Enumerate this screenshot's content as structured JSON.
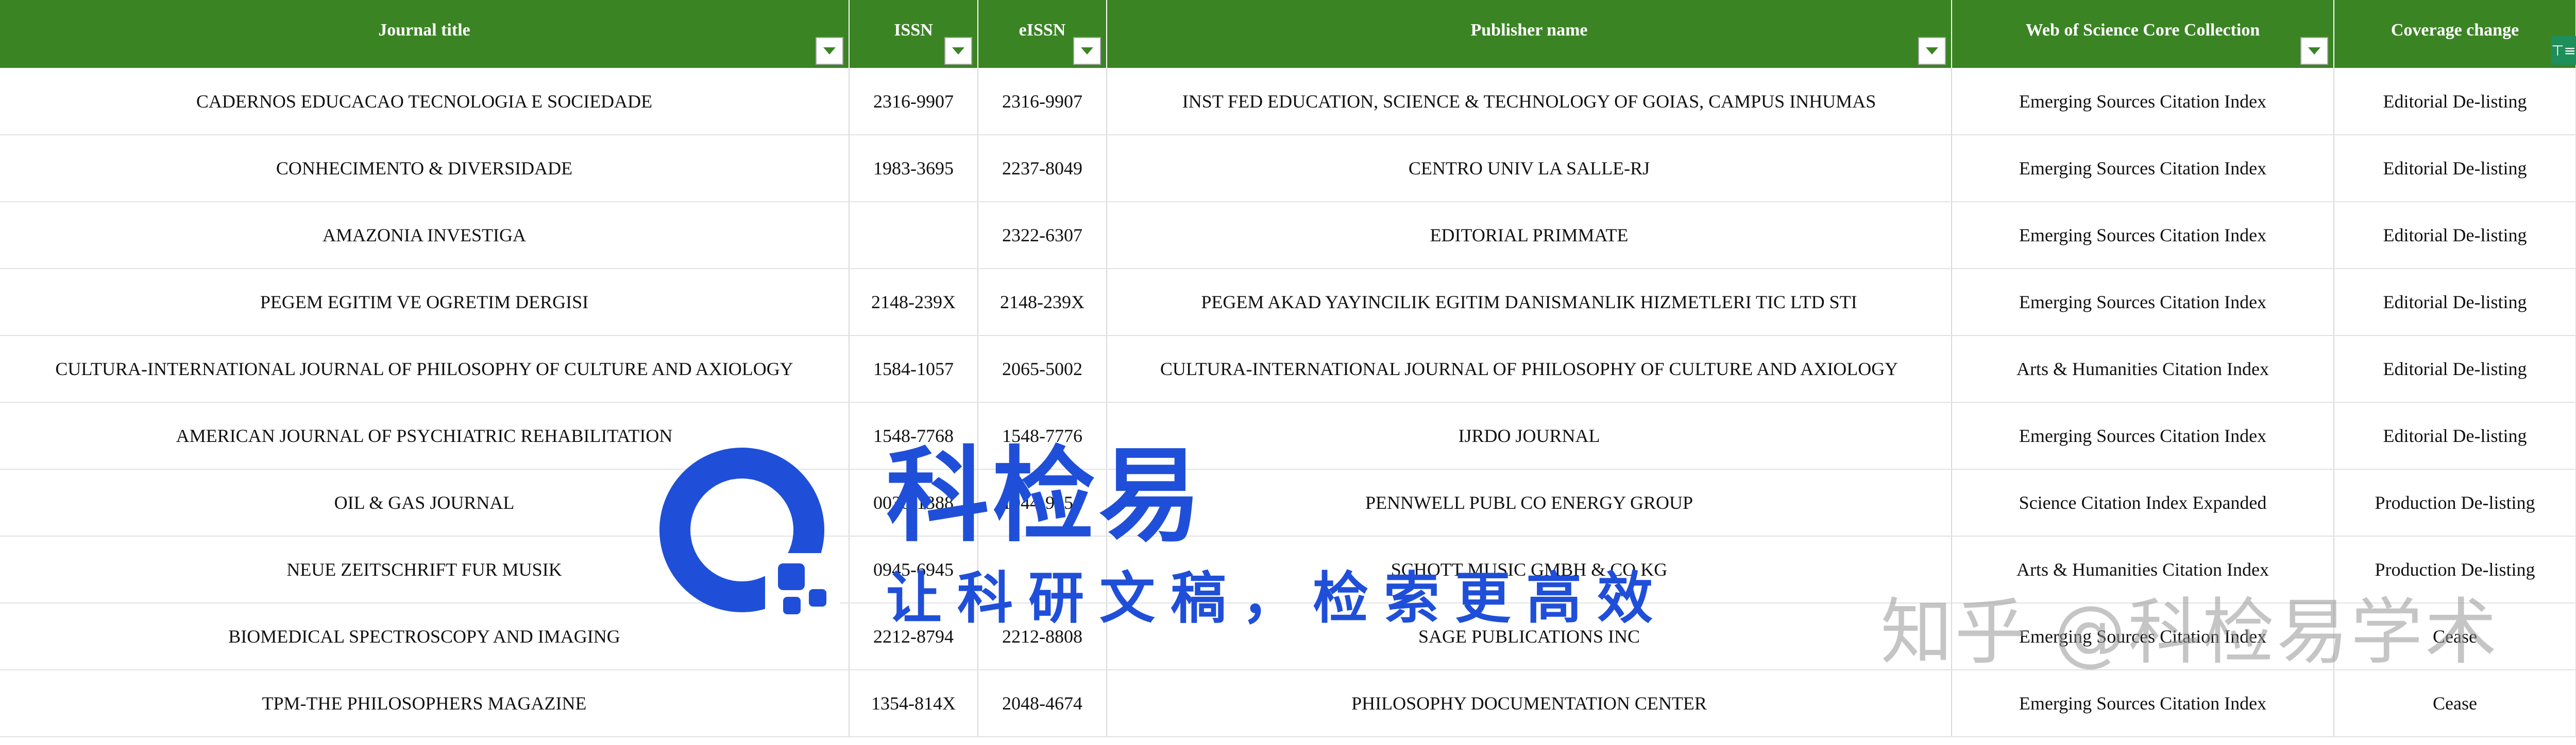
{
  "columns": [
    {
      "label": "Journal title",
      "filter": true
    },
    {
      "label": "ISSN",
      "filter": true
    },
    {
      "label": "eISSN",
      "filter": true
    },
    {
      "label": "Publisher name",
      "filter": true
    },
    {
      "label": "Web of Science Core Collection",
      "filter": true
    },
    {
      "label": "Coverage change",
      "filter": true
    }
  ],
  "rows": [
    [
      "CADERNOS EDUCACAO TECNOLOGIA E SOCIEDADE",
      "2316-9907",
      "2316-9907",
      "INST FED EDUCATION, SCIENCE & TECHNOLOGY OF GOIAS, CAMPUS INHUMAS",
      "Emerging Sources Citation Index",
      "Editorial De-listing"
    ],
    [
      "CONHECIMENTO & DIVERSIDADE",
      "1983-3695",
      "2237-8049",
      "CENTRO UNIV LA SALLE-RJ",
      "Emerging Sources Citation Index",
      "Editorial De-listing"
    ],
    [
      "AMAZONIA INVESTIGA",
      "",
      "2322-6307",
      "EDITORIAL PRIMMATE",
      "Emerging Sources Citation Index",
      "Editorial De-listing"
    ],
    [
      "PEGEM EGITIM VE OGRETIM DERGISI",
      "2148-239X",
      "2148-239X",
      "PEGEM AKAD YAYINCILIK EGITIM DANISMANLIK HIZMETLERI TIC LTD STI",
      "Emerging Sources Citation Index",
      "Editorial De-listing"
    ],
    [
      "CULTURA-INTERNATIONAL JOURNAL OF PHILOSOPHY OF CULTURE AND AXIOLOGY",
      "1584-1057",
      "2065-5002",
      "CULTURA-INTERNATIONAL JOURNAL OF PHILOSOPHY OF CULTURE AND AXIOLOGY",
      "Arts & Humanities Citation Index",
      "Editorial De-listing"
    ],
    [
      "AMERICAN JOURNAL OF PSYCHIATRIC REHABILITATION",
      "1548-7768",
      "1548-7776",
      "IJRDO JOURNAL",
      "Emerging Sources Citation Index",
      "Editorial De-listing"
    ],
    [
      "OIL & GAS JOURNAL",
      "0030-1388",
      "1944-9151",
      "PENNWELL PUBL CO ENERGY GROUP",
      "Science Citation Index Expanded",
      "Production De-listing"
    ],
    [
      "NEUE ZEITSCHRIFT FUR MUSIK",
      "0945-6945",
      "",
      "SCHOTT MUSIC GMBH & CO KG",
      "Arts & Humanities Citation Index",
      "Production De-listing"
    ],
    [
      "BIOMEDICAL SPECTROSCOPY AND IMAGING",
      "2212-8794",
      "2212-8808",
      "SAGE PUBLICATIONS INC",
      "Emerging Sources Citation Index",
      "Cease"
    ],
    [
      "TPM-THE PHILOSOPHERS MAGAZINE",
      "1354-814X",
      "2048-4674",
      "PHILOSOPHY DOCUMENTATION CENTER",
      "Emerging Sources Citation Index",
      "Cease"
    ]
  ],
  "watermark": {
    "brand": "科检易",
    "slogan": "让科研文稿，检索更高效",
    "zhihu": "知乎 @科检易学术"
  },
  "colors": {
    "header_bg": "#3b8424",
    "header_text": "#ffffff",
    "brand_blue": "#1f4fd9"
  }
}
